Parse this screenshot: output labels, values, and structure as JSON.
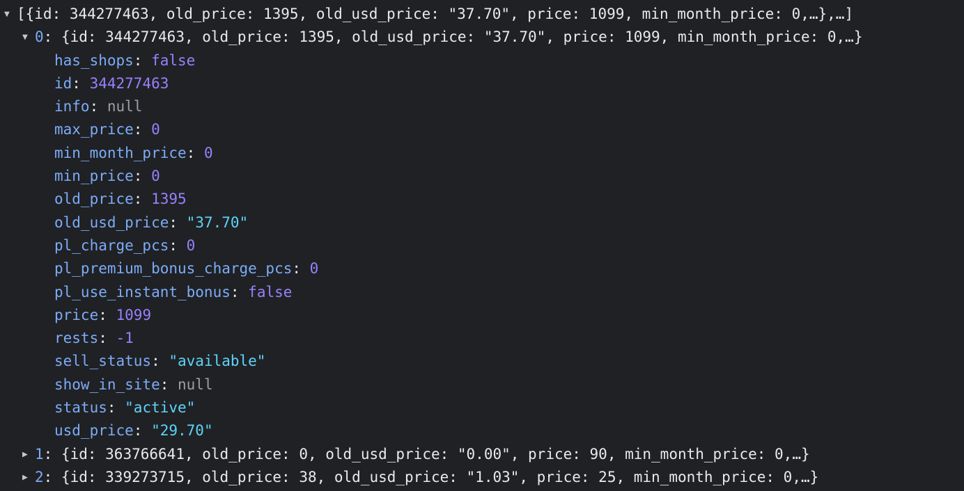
{
  "root": {
    "toggle": "expanded",
    "preview": "[{id: 344277463, old_price: 1395, old_usd_price: \"37.70\", price: 1099, min_month_price: 0,…},…]"
  },
  "items": [
    {
      "index": "0",
      "toggle": "expanded",
      "preview": "{id: 344277463, old_price: 1395, old_usd_price: \"37.70\", price: 1099, min_month_price: 0,…}",
      "properties": [
        {
          "key": "has_shops",
          "value": "false",
          "type": "bool"
        },
        {
          "key": "id",
          "value": "344277463",
          "type": "num"
        },
        {
          "key": "info",
          "value": "null",
          "type": "nul"
        },
        {
          "key": "max_price",
          "value": "0",
          "type": "num"
        },
        {
          "key": "min_month_price",
          "value": "0",
          "type": "num"
        },
        {
          "key": "min_price",
          "value": "0",
          "type": "num"
        },
        {
          "key": "old_price",
          "value": "1395",
          "type": "num"
        },
        {
          "key": "old_usd_price",
          "value": "\"37.70\"",
          "type": "str"
        },
        {
          "key": "pl_charge_pcs",
          "value": "0",
          "type": "num"
        },
        {
          "key": "pl_premium_bonus_charge_pcs",
          "value": "0",
          "type": "num"
        },
        {
          "key": "pl_use_instant_bonus",
          "value": "false",
          "type": "bool"
        },
        {
          "key": "price",
          "value": "1099",
          "type": "num"
        },
        {
          "key": "rests",
          "value": "-1",
          "type": "num"
        },
        {
          "key": "sell_status",
          "value": "\"available\"",
          "type": "str"
        },
        {
          "key": "show_in_site",
          "value": "null",
          "type": "nul"
        },
        {
          "key": "status",
          "value": "\"active\"",
          "type": "str"
        },
        {
          "key": "usd_price",
          "value": "\"29.70\"",
          "type": "str"
        }
      ]
    },
    {
      "index": "1",
      "toggle": "collapsed",
      "preview": "{id: 363766641, old_price: 0, old_usd_price: \"0.00\", price: 90, min_month_price: 0,…}"
    },
    {
      "index": "2",
      "toggle": "collapsed",
      "preview": "{id: 339273715, old_price: 38, old_usd_price: \"1.03\", price: 25, min_month_price: 0,…}"
    }
  ],
  "colors": {
    "background": "#202124",
    "key": "#7cacf8",
    "number": "#9980ff",
    "string": "#5cd5fb",
    "null": "#9aa0a6",
    "text": "#e8eaed"
  },
  "icons": {
    "expanded": "triangle-down-icon",
    "collapsed": "triangle-right-icon"
  }
}
